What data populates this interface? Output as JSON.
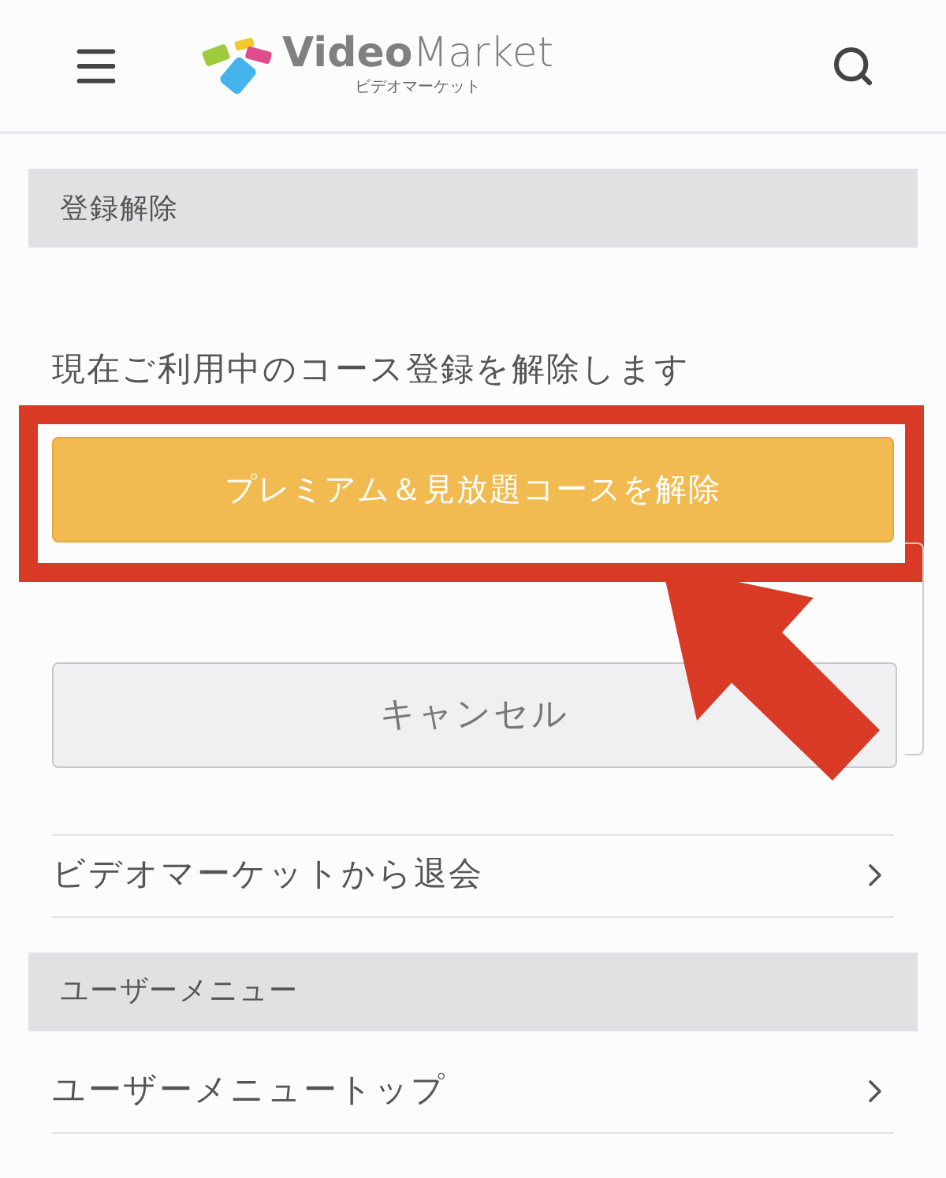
{
  "header": {
    "logo": {
      "bold": "Video",
      "light": "Market",
      "subtitle": "ビデオマーケット"
    }
  },
  "sections": [
    {
      "title": "登録解除",
      "kind": "cancel_form",
      "description": "現在ご利用中のコース登録を解除します",
      "primary_button": "プレミアム＆見放題コースを解除",
      "secondary_button": "キャンセル",
      "highlighted": true,
      "links": [
        {
          "label": "ビデオマーケットから退会"
        }
      ]
    },
    {
      "title": "ユーザーメニュー",
      "kind": "menu",
      "links": [
        {
          "label": "ユーザーメニュートップ"
        }
      ]
    }
  ]
}
